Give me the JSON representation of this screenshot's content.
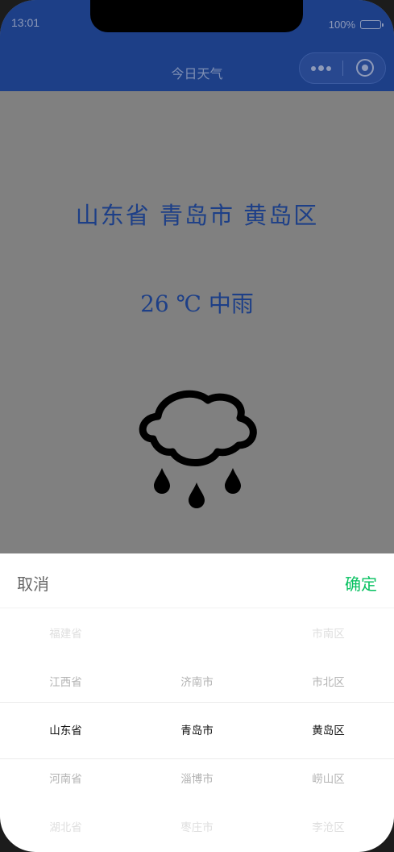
{
  "status": {
    "time": "13:01",
    "battery": "100%"
  },
  "navbar": {
    "title": "今日天气"
  },
  "main": {
    "location": "山东省 青岛市 黄岛区",
    "weather": "26 ℃ 中雨",
    "weather_icon": "rain-cloud-icon"
  },
  "picker": {
    "cancel_label": "取消",
    "confirm_label": "确定",
    "accent_color": "#07c160",
    "columns": [
      {
        "name": "province",
        "items": [
          "福建省",
          "江西省",
          "山东省",
          "河南省",
          "湖北省"
        ]
      },
      {
        "name": "city",
        "items": [
          "",
          "济南市",
          "青岛市",
          "淄博市",
          "枣庄市"
        ]
      },
      {
        "name": "district",
        "items": [
          "市南区",
          "市北区",
          "黄岛区",
          "崂山区",
          "李沧区"
        ]
      }
    ]
  },
  "colors": {
    "header_bg": "#1d3f87",
    "overlay_bg": "#808080",
    "text_accent": "#1d3f87"
  }
}
